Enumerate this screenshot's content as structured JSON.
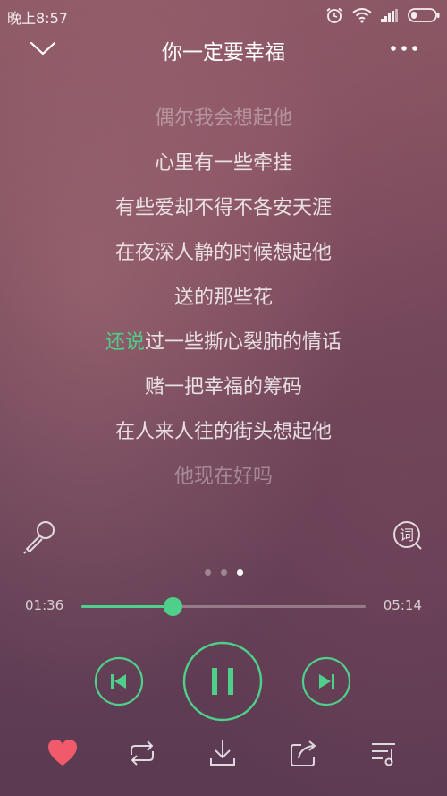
{
  "status_bar": {
    "time": "晚上8:57",
    "icons": [
      "alarm-icon",
      "wifi-icon",
      "signal-icon",
      "battery-icon"
    ]
  },
  "header": {
    "back_icon": "chevron-down-icon",
    "title": "你一定要幸福",
    "more_icon": "more-dots-icon"
  },
  "lyrics": {
    "lines": [
      "偶尔我会想起他",
      "心里有一些牵挂",
      "有些爱却不得不各安天涯",
      "在夜深人静的时候想起他",
      "送的那些花",
      "还说过一些撕心裂肺的情话",
      "赌一把幸福的筹码",
      "在人来人往的街头想起他",
      "他现在好吗"
    ],
    "current_line": {
      "sung": "还说",
      "rest": "过一些撕心裂肺的情话"
    }
  },
  "side_icons": {
    "left": "microphone-icon",
    "right_icon": "lyrics-icon",
    "right_text": "词"
  },
  "pager": {
    "count": 3,
    "active_index": 2
  },
  "progress": {
    "current_time": "01:36",
    "duration": "05:14",
    "fraction": 0.32
  },
  "controls": {
    "prev_icon": "previous-track-icon",
    "play_icon": "pause-icon",
    "next_icon": "next-track-icon"
  },
  "toolbar": {
    "icons": [
      "heart-icon",
      "repeat-icon",
      "download-icon",
      "share-icon",
      "playlist-icon"
    ]
  },
  "colors": {
    "accent": "#4fd08a",
    "favorite": "#f05a6a",
    "text": "#ffffff"
  }
}
